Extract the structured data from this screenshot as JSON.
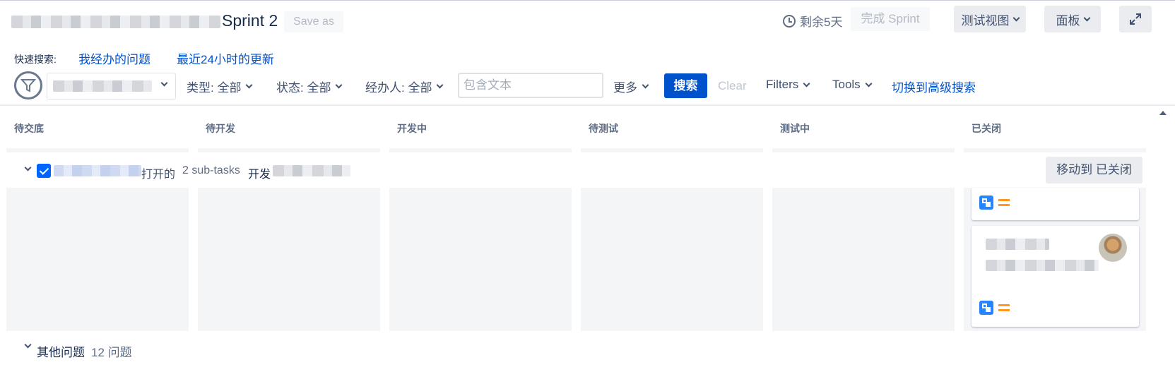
{
  "header": {
    "sprint_name": "Sprint 2",
    "save_as": "Save as",
    "remaining": "剩余5天",
    "complete_sprint": "完成 Sprint",
    "view_button": "测试视图",
    "board_button": "面板"
  },
  "quick_search": {
    "label": "快速搜索:",
    "links": [
      "我经办的问题",
      "最近24小时的更新"
    ]
  },
  "filters": {
    "type": "类型: 全部",
    "status": "状态: 全部",
    "assignee": "经办人: 全部",
    "text_placeholder": "包含文本",
    "more": "更多",
    "search": "搜索",
    "clear": "Clear",
    "filters": "Filters",
    "tools": "Tools",
    "advanced": "切换到高级搜索"
  },
  "columns": [
    "待交底",
    "待开发",
    "开发中",
    "待测试",
    "测试中",
    "已关闭"
  ],
  "swimlane": {
    "status_suffix": "打开的",
    "subtasks": "2 sub-tasks",
    "assignee_prefix": "开发",
    "move_button": "移动到 已关闭"
  },
  "other_issues": {
    "label": "其他问题",
    "count": "12 问题"
  },
  "colors": {
    "primary": "#0052cc",
    "story": "#2684ff",
    "priority": "#ff991f"
  }
}
